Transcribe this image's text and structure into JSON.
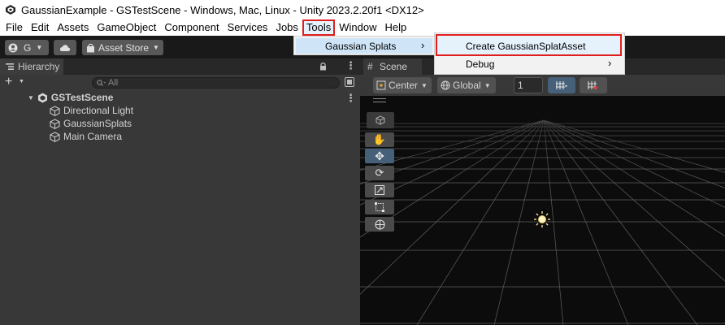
{
  "window": {
    "title": "GaussianExample - GSTestScene - Windows, Mac, Linux - Unity 2023.2.20f1 <DX12>"
  },
  "menubar": {
    "items": [
      "File",
      "Edit",
      "Assets",
      "GameObject",
      "Component",
      "Services",
      "Jobs",
      "Tools",
      "Window",
      "Help"
    ]
  },
  "toolbar": {
    "account_label": "G",
    "asset_store_label": "Asset Store"
  },
  "hierarchy": {
    "tab_label": "Hierarchy",
    "search_placeholder": "All",
    "scene_name": "GSTestScene",
    "objects": [
      "Directional Light",
      "GaussianSplats",
      "Main Camera"
    ]
  },
  "scene_view": {
    "tab_label": "Scene",
    "pivot_label": "Center",
    "space_label": "Global",
    "grid_snap_value": "1"
  },
  "tools_menu": {
    "gaussian_splats_label": "Gaussian Splats",
    "submenu": {
      "create_label": "Create GaussianSplatAsset",
      "debug_label": "Debug"
    }
  },
  "colors": {
    "highlight_outline": "#e01e1e",
    "panel_bg": "#383838",
    "scene_bg": "#0c0c0c"
  }
}
